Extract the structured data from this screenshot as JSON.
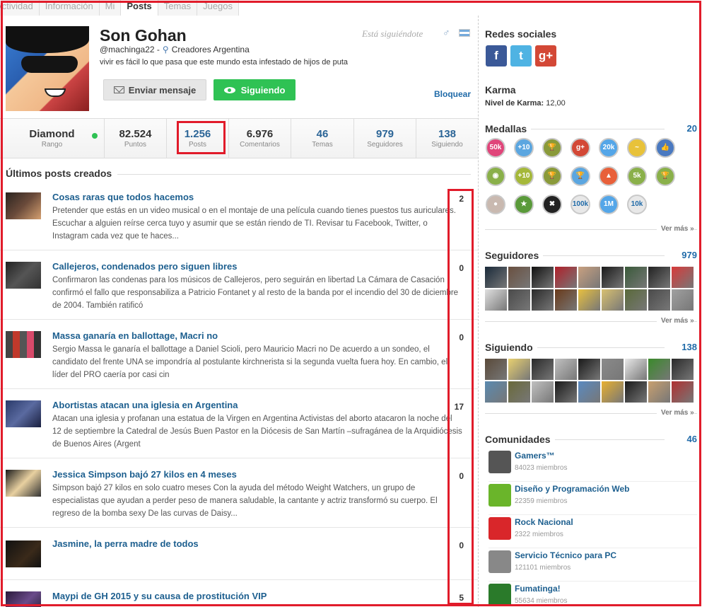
{
  "tabs": [
    {
      "label": "Actividad",
      "active": false
    },
    {
      "label": "Información",
      "active": false
    },
    {
      "label": "Mi",
      "active": false
    },
    {
      "label": "Posts",
      "active": true
    },
    {
      "label": "Temas",
      "active": false
    },
    {
      "label": "Juegos",
      "active": false
    }
  ],
  "profile": {
    "name": "Son Gohan",
    "following_you": "Está siguiéndote",
    "username": "@machinga22 -",
    "community": "Creadores Argentina",
    "bio": "vivir es fácil lo que pasa que este mundo esta infestado de hijos de puta",
    "message_button": "Enviar mensaje",
    "following_button": "Siguiendo",
    "block_link": "Bloquear",
    "gender_icon": "male-icon",
    "flag_icon": "argentina-flag-icon"
  },
  "stats": [
    {
      "value": "Diamond",
      "label": "Rango"
    },
    {
      "value": "82.524",
      "label": "Puntos"
    },
    {
      "value": "1.256",
      "label": "Posts"
    },
    {
      "value": "6.976",
      "label": "Comentarios"
    },
    {
      "value": "46",
      "label": "Temas"
    },
    {
      "value": "979",
      "label": "Seguidores"
    },
    {
      "value": "138",
      "label": "Siguiendo"
    }
  ],
  "posts_section": {
    "heading": "Últimos posts creados",
    "posts": [
      {
        "title": "Cosas raras que todos hacemos",
        "excerpt": "Pretender que estás en un video musical o en el montaje de una película cuando tienes puestos tus auriculares. Escuchar a alguien reírse cerca tuyo y asumir que se están riendo de TI. Revisar tu Facebook, Twitter, o Instagram cada vez que te haces...",
        "count": "2"
      },
      {
        "title": "Callejeros, condenados pero siguen libres",
        "excerpt": "Confirmaron las condenas para los músicos de Callejeros, pero seguirán en libertad La Cámara de Casación confirmó el fallo que responsabiliza a Patricio Fontanet y al resto de la banda por el incendio del 30 de diciembre de 2004. También ratificó",
        "count": "0"
      },
      {
        "title": "Massa ganaría en ballottage, Macri no",
        "excerpt": "Sergio Massa le ganaría el ballottage a Daniel Scioli, pero Mauricio Macri no De acuerdo a un sondeo, el candidato del frente UNA se impondría al postulante kirchnerista si la segunda vuelta fuera hoy. En cambio, el líder del PRO caería por casi cin",
        "count": "0"
      },
      {
        "title": "Abortistas atacan una iglesia en Argentina",
        "excerpt": "Atacan una iglesia y profanan una estatua de la Virgen en Argentina Activistas del aborto atacaron la noche del 12 de septiembre la Catedral de Jesús Buen Pastor en la Diócesis de San Martín –sufragánea de la Arquidiócesis de Buenos Aires (Argent",
        "count": "17"
      },
      {
        "title": "Jessica Simpson bajó 27 kilos en 4 meses",
        "excerpt": "Simpson bajó 27 kilos en solo cuatro meses Con la ayuda del método Weight Watchers, un grupo de especialistas que ayudan a perder peso de manera saludable, la cantante y actriz transformó su cuerpo. El regreso de la bomba sexy De las curvas de Daisy...",
        "count": "0"
      },
      {
        "title": "Jasmine, la perra madre de todos",
        "excerpt": "",
        "count": "0"
      },
      {
        "title": "Maypi de GH 2015 y su causa de prostitución VIP",
        "excerpt": "",
        "count": "5"
      }
    ]
  },
  "sidebar": {
    "social": {
      "heading": "Redes sociales",
      "items": [
        {
          "name": "facebook-icon",
          "glyph": "f",
          "color": "#3b5998"
        },
        {
          "name": "twitter-icon",
          "glyph": "t",
          "color": "#4fb3e3"
        },
        {
          "name": "google-plus-icon",
          "glyph": "g+",
          "color": "#d34836"
        }
      ]
    },
    "karma": {
      "heading": "Karma",
      "label": "Nivel de Karma:",
      "value": "12,00"
    },
    "medals": {
      "heading": "Medallas",
      "count": "20",
      "more": "Ver más »",
      "items": [
        {
          "name": "medal-50k-icon",
          "text": "50k",
          "color": "#e0457a"
        },
        {
          "name": "medal-plus10-icon",
          "text": "+10",
          "color": "#5ba6e0"
        },
        {
          "name": "medal-trophy-icon",
          "text": "🏆",
          "color": "#8a9a3a"
        },
        {
          "name": "medal-gplus-icon",
          "text": "g+",
          "color": "#d34836"
        },
        {
          "name": "medal-20k-icon",
          "text": "20k",
          "color": "#54a6e8"
        },
        {
          "name": "medal-bird-icon",
          "text": "~",
          "color": "#e8c23a"
        },
        {
          "name": "medal-like-icon",
          "text": "👍",
          "color": "#4a79c0"
        },
        {
          "name": "medal-eye-icon",
          "text": "◉",
          "color": "#8ab04a"
        },
        {
          "name": "medal-plus10b-icon",
          "text": "+10",
          "color": "#a5b83a"
        },
        {
          "name": "medal-trophy2-icon",
          "text": "🏆",
          "color": "#8a9a3a"
        },
        {
          "name": "medal-trophy3-icon",
          "text": "🏆",
          "color": "#5ba6e0"
        },
        {
          "name": "medal-crown-icon",
          "text": "▲",
          "color": "#e8603a"
        },
        {
          "name": "medal-5k-icon",
          "text": "5k",
          "color": "#8ab04a"
        },
        {
          "name": "medal-trophy4-icon",
          "text": "🏆",
          "color": "#8ab04a"
        },
        {
          "name": "medal-user-icon",
          "text": "●",
          "color": "#c9b9b0"
        },
        {
          "name": "medal-star-icon",
          "text": "★",
          "color": "#5a9a3a"
        },
        {
          "name": "medal-x-icon",
          "text": "✖",
          "color": "#222"
        },
        {
          "name": "medal-100k-icon",
          "text": "100k",
          "color": "#e8e8e8"
        },
        {
          "name": "medal-1m-icon",
          "text": "1M",
          "color": "#54a6e8"
        },
        {
          "name": "medal-10k-icon",
          "text": "10k",
          "color": "#e8e8e8"
        }
      ]
    },
    "followers": {
      "heading": "Seguidores",
      "count": "979",
      "more": "Ver más »"
    },
    "following": {
      "heading": "Siguiendo",
      "count": "138",
      "more": "Ver más »"
    },
    "communities": {
      "heading": "Comunidades",
      "count": "46",
      "items": [
        {
          "name": "Gamers™",
          "members": "84023 miembros",
          "icon": "gamers-icon",
          "color": "#555"
        },
        {
          "name": "Diseño y Programación Web",
          "members": "22359 miembros",
          "icon": "dpw-icon",
          "color": "#6ab52a"
        },
        {
          "name": "Rock Nacional",
          "members": "2322 miembros",
          "icon": "rock-hand-icon",
          "color": "#d9262a"
        },
        {
          "name": "Servicio Técnico para PC",
          "members": "121101 miembros",
          "icon": "pc-icon",
          "color": "#888"
        },
        {
          "name": "Fumatinga!",
          "members": "55634 miembros",
          "icon": "leaf-icon",
          "color": "#2a7a2a"
        }
      ]
    }
  },
  "colors": {
    "accent": "#1f6aa8",
    "follow_green": "#2fc254",
    "highlight_red": "#e11b2a"
  }
}
